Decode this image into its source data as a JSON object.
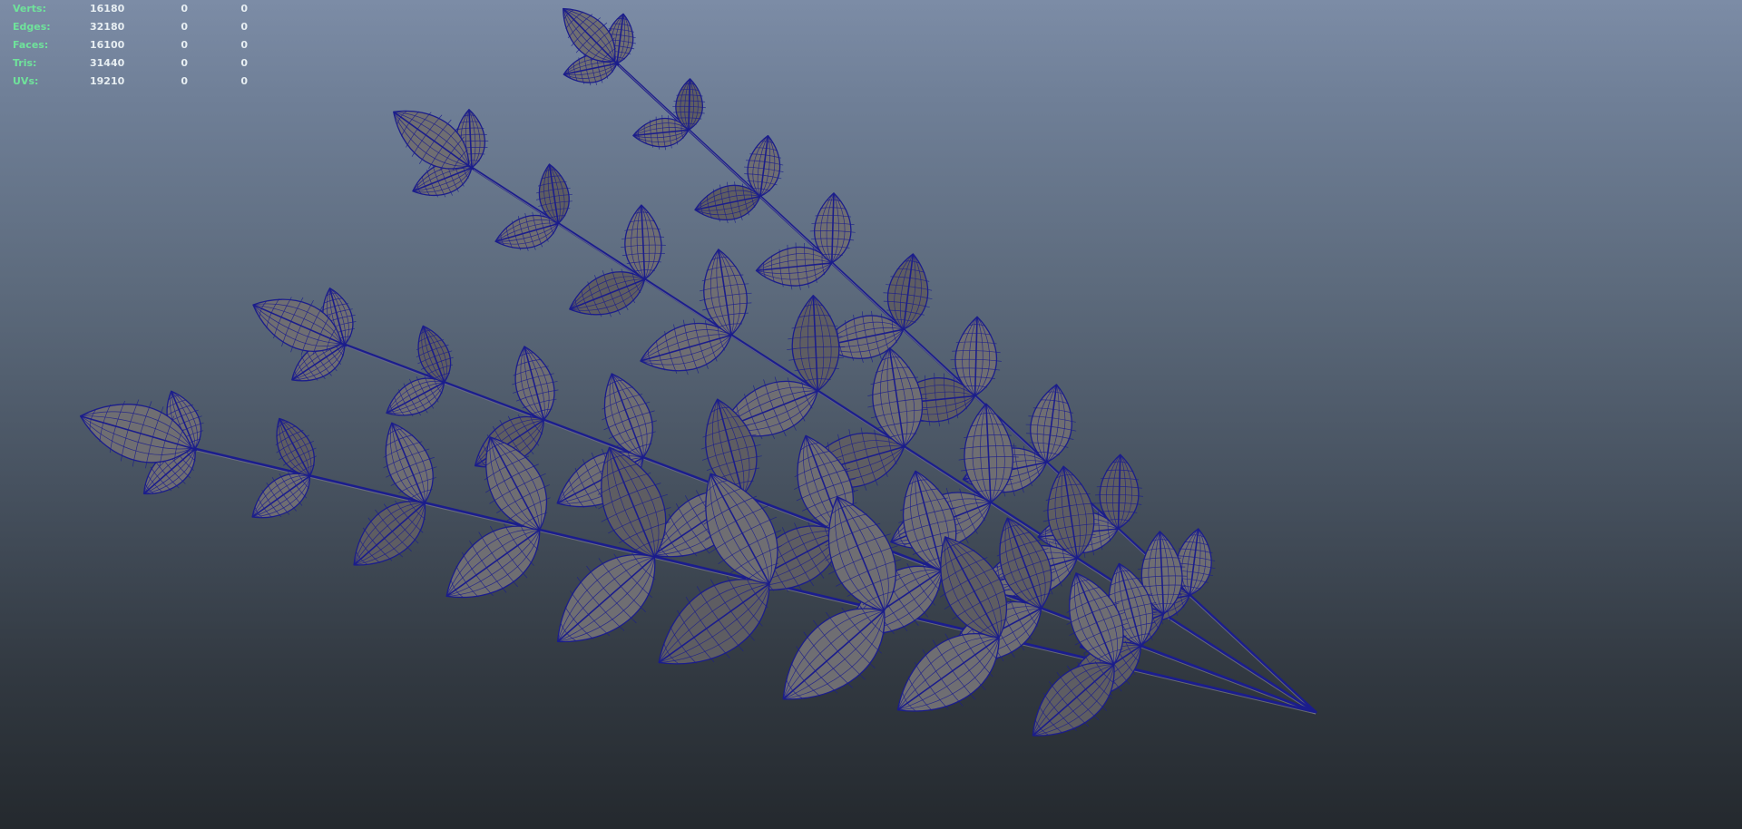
{
  "hud": {
    "rows": [
      {
        "label": "Verts:",
        "total": "16180",
        "selected": "0",
        "component": "0"
      },
      {
        "label": "Edges:",
        "total": "32180",
        "selected": "0",
        "component": "0"
      },
      {
        "label": "Faces:",
        "total": "16100",
        "selected": "0",
        "component": "0"
      },
      {
        "label": "Tris:",
        "total": "31440",
        "selected": "0",
        "component": "0"
      },
      {
        "label": "UVs:",
        "total": "19210",
        "selected": "0",
        "component": "0"
      }
    ]
  },
  "colors": {
    "wire": "#1b1d8c",
    "leaf_fill": "#6f6e72",
    "leaf_fill_dark": "#5e5d62",
    "hud_label": "#6fe39b",
    "hud_value": "#e7eef2"
  }
}
